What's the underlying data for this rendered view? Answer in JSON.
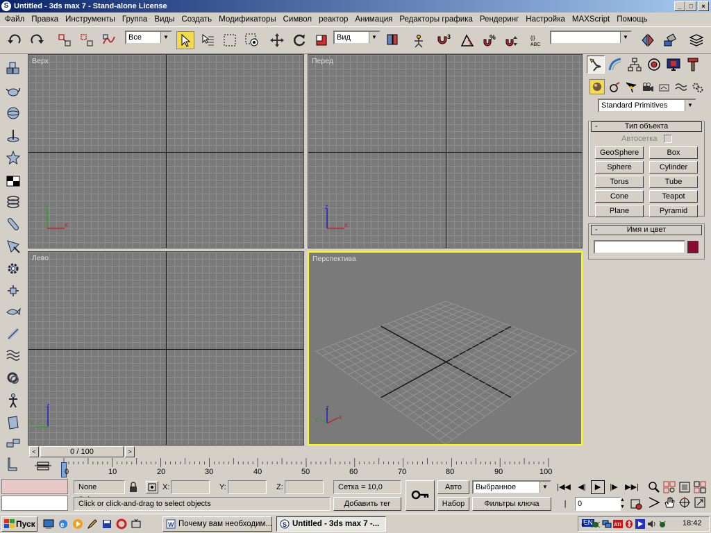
{
  "window": {
    "title": "Untitled - 3ds max 7 - Stand-alone License",
    "app_icon": "3ds-max-icon",
    "min_icon": "minimize-icon",
    "max_icon": "maximize-icon",
    "close_icon": "close-icon"
  },
  "menu": [
    "Файл",
    "Правка",
    "Инструменты",
    "Группа",
    "Виды",
    "Создать",
    "Модификаторы",
    "Символ",
    "реактор",
    "Анимация",
    "Редакторы графика",
    "Рендеринг",
    "Настройка",
    "MAXScript",
    "Помощь"
  ],
  "toolbar": {
    "selection_filter": "Все",
    "reference_coord": "Вид",
    "named_selection": ""
  },
  "viewports": [
    {
      "label": "Верх",
      "axis1": "y",
      "axis2": "x"
    },
    {
      "label": "Перед",
      "axis1": "z",
      "axis2": "x"
    },
    {
      "label": "Лево",
      "axis1": "z",
      "axis2": "y"
    },
    {
      "label": "Перспектива",
      "axis1": "z",
      "axis2": "x",
      "axis3": "y"
    }
  ],
  "command_panel": {
    "category_dropdown": "Standard Primitives",
    "object_type_title": "Тип объекта",
    "autogrid_label": "Автосетка",
    "primitives": [
      "GeoSphere",
      "Box",
      "Sphere",
      "Cylinder",
      "Torus",
      "Tube",
      "Cone",
      "Teapot",
      "Plane",
      "Pyramid"
    ],
    "name_color_title": "Имя и цвет",
    "object_name": "",
    "object_color": "#8b0a33",
    "rollout_sign": "-"
  },
  "timeline": {
    "frame_display": "0 / 100",
    "ticks": [
      "0",
      "10",
      "20",
      "30",
      "40",
      "50",
      "60",
      "70",
      "80",
      "90",
      "100"
    ]
  },
  "status": {
    "selection": "None Selecte",
    "x_label": "X:",
    "y_label": "Y:",
    "z_label": "Z:",
    "x_value": "",
    "y_value": "",
    "z_value": "",
    "prompt": "Click or click-and-drag to select objects",
    "grid": "Сетка = 10,0",
    "add_tag": "Добавить тег",
    "auto_key": "Авто",
    "set_key": "Набор",
    "key_mode": "Выбранное",
    "key_filters": "Фильтры ключа",
    "current_frame": "0"
  },
  "taskbar": {
    "start": "Пуск",
    "tasks": [
      "Почему вам необходим...",
      "Untitled - 3ds max 7 -..."
    ],
    "tray_lang": "EN",
    "tray_chevron": "«",
    "clock": "18:42"
  }
}
